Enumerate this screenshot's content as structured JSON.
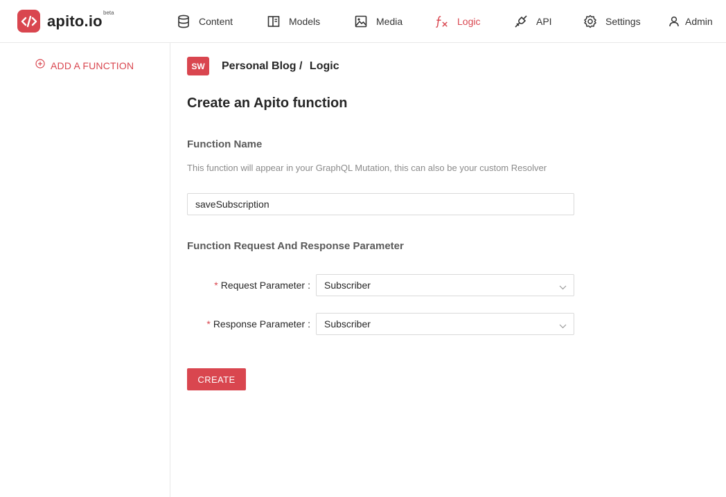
{
  "app": {
    "logo_text": "apito.io",
    "beta_label": "beta",
    "brand_color": "#d9464f"
  },
  "nav": {
    "items": [
      {
        "label": "Content",
        "icon": "database-icon"
      },
      {
        "label": "Models",
        "icon": "model-icon"
      },
      {
        "label": "Media",
        "icon": "image-icon"
      },
      {
        "label": "Logic",
        "icon": "function-icon",
        "active": true
      },
      {
        "label": "API",
        "icon": "plug-icon"
      },
      {
        "label": "Settings",
        "icon": "gear-icon"
      },
      {
        "label": "Admin",
        "icon": "user-icon"
      }
    ]
  },
  "sidebar": {
    "add_function_label": "ADD A FUNCTION"
  },
  "breadcrumb": {
    "avatar": "SW",
    "project": "Personal Blog /",
    "section": "Logic"
  },
  "form": {
    "title": "Create an Apito function",
    "function_name_title": "Function Name",
    "function_name_help": "This function will appear in your GraphQL Mutation, this can also be your custom Resolver",
    "function_name_value": "saveSubscription",
    "params_title": "Function Request And Response Parameter",
    "request_label": "Request Parameter",
    "request_value": "Subscriber",
    "response_label": "Response Parameter",
    "response_value": "Subscriber",
    "required_mark": "*",
    "colon": ":",
    "create_label": "CREATE"
  }
}
